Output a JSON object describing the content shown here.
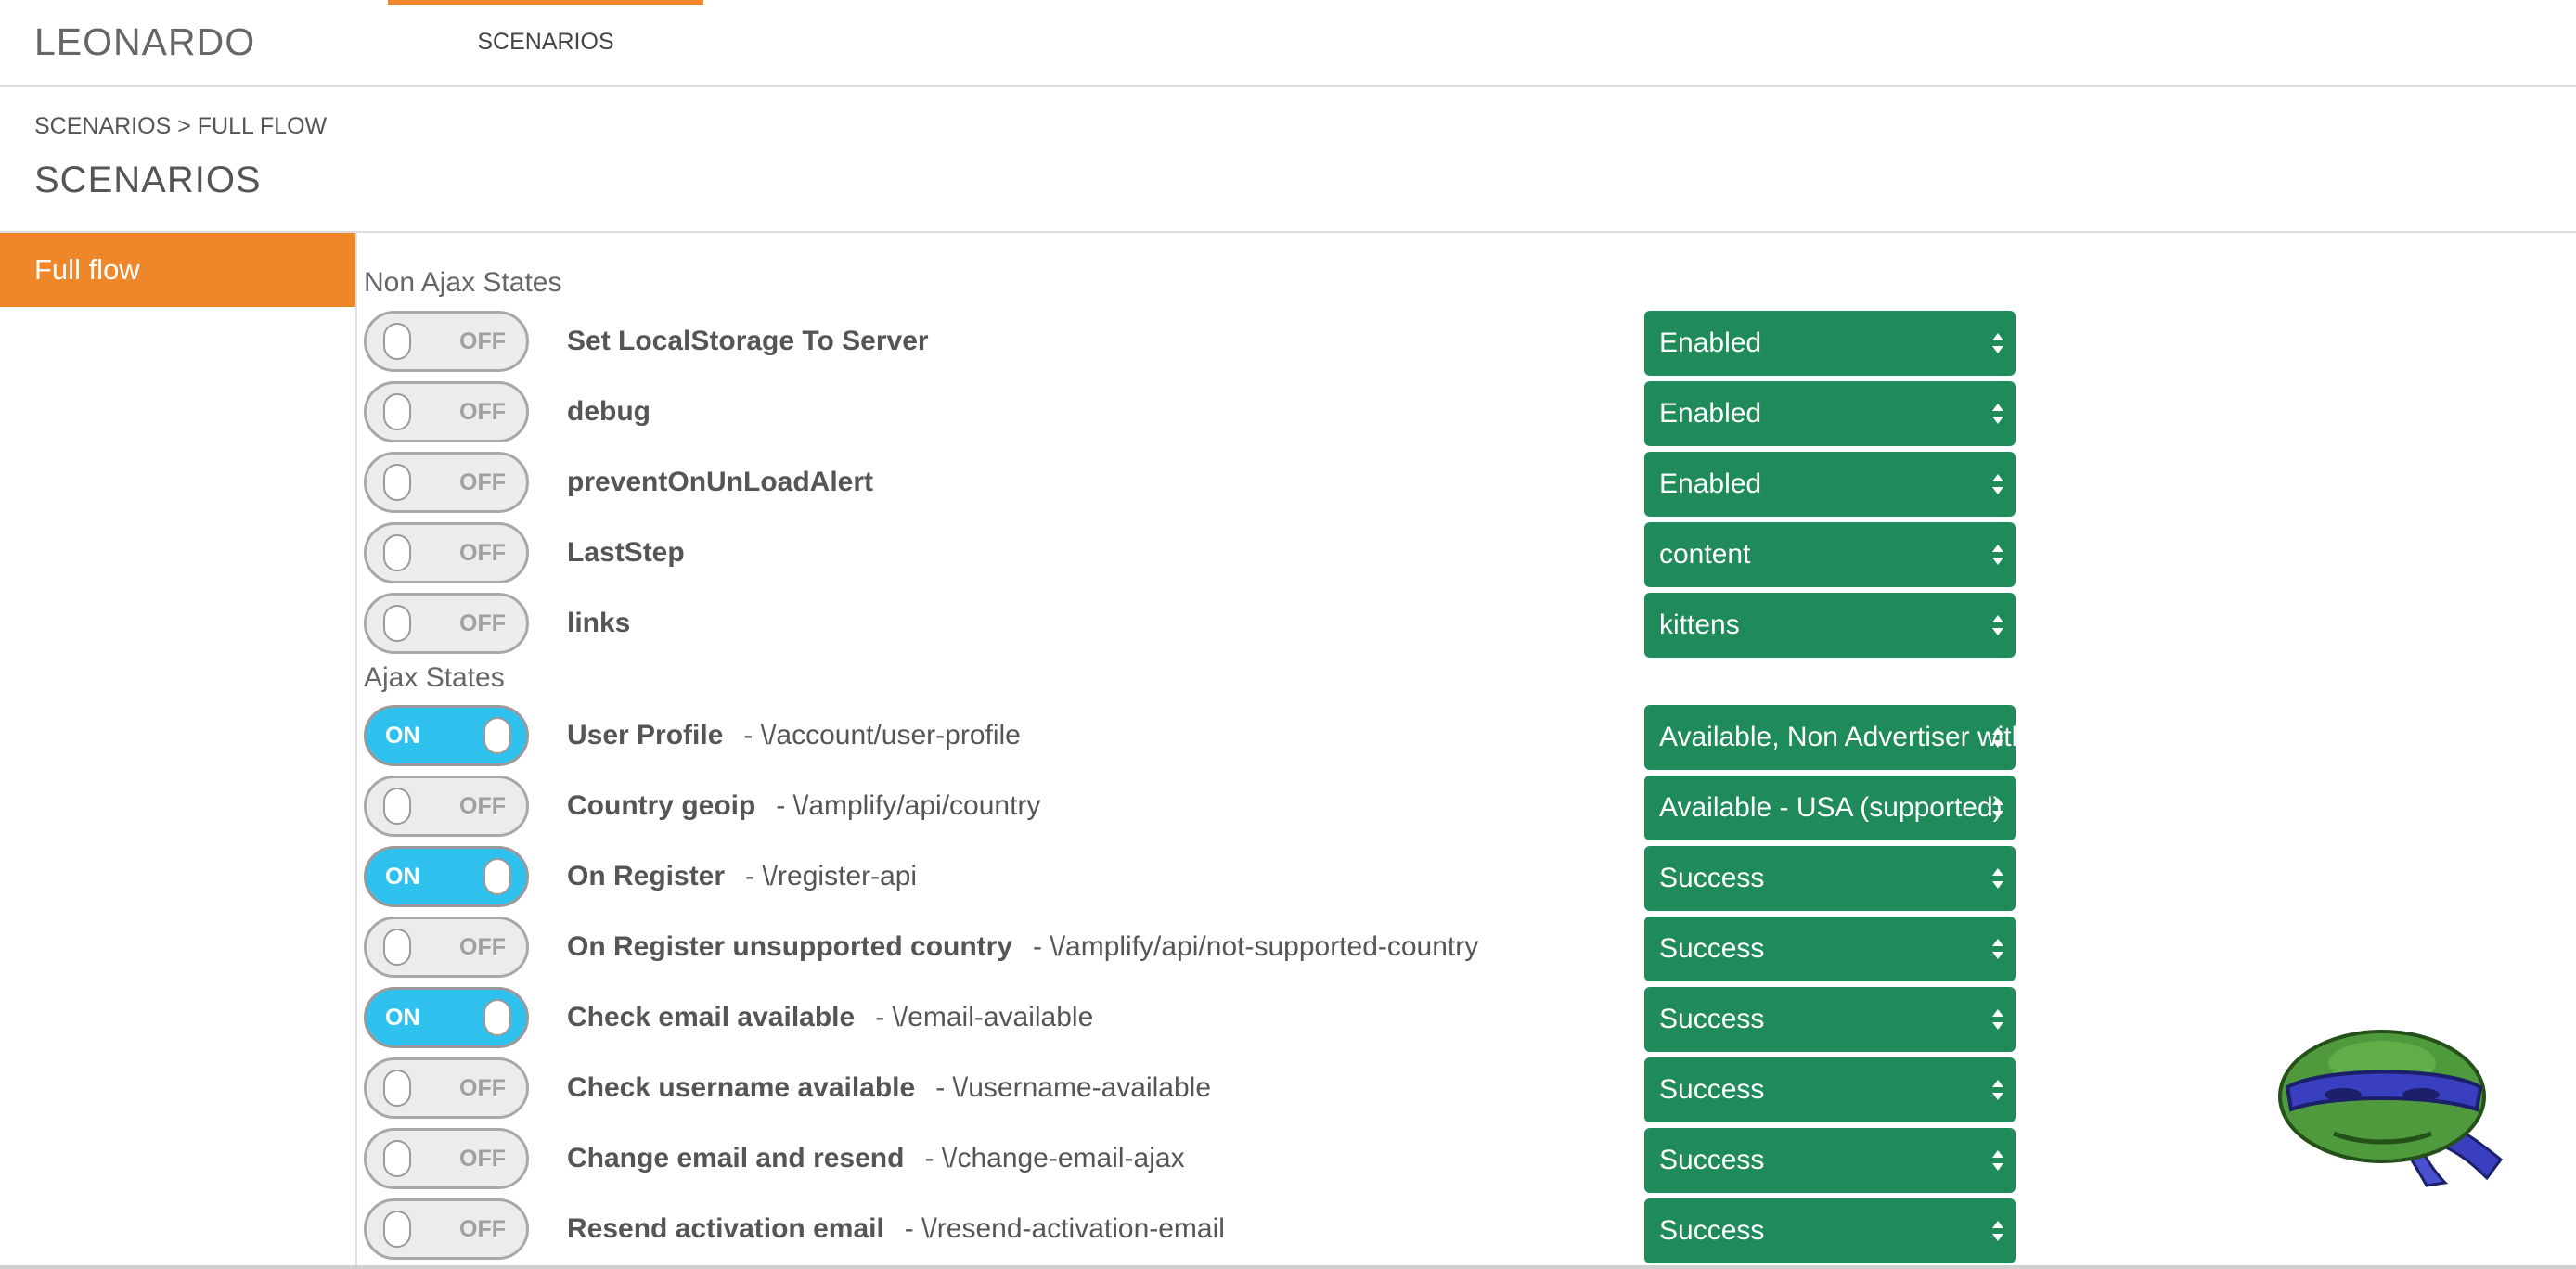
{
  "header": {
    "brand": "LEONARDO",
    "nav_tab": "SCENARIOS"
  },
  "breadcrumb": "SCENARIOS > FULL FLOW",
  "page_title": "SCENARIOS",
  "sidebar": {
    "items": [
      {
        "label": "Full flow",
        "active": true
      }
    ]
  },
  "colors": {
    "accent": "#f0862a",
    "toggle_on": "#2fc2ef",
    "select_bg": "#1f8a5a"
  },
  "non_ajax": {
    "title": "Non Ajax States",
    "rows": [
      {
        "name": "Set LocalStorage To Server",
        "path": "",
        "state": "OFF",
        "value": "Enabled"
      },
      {
        "name": "debug",
        "path": "",
        "state": "OFF",
        "value": "Enabled"
      },
      {
        "name": "preventOnUnLoadAlert",
        "path": "",
        "state": "OFF",
        "value": "Enabled"
      },
      {
        "name": "LastStep",
        "path": "",
        "state": "OFF",
        "value": "content"
      },
      {
        "name": "links",
        "path": "",
        "state": "OFF",
        "value": "kittens"
      }
    ]
  },
  "ajax": {
    "title": "Ajax States",
    "rows": [
      {
        "name": "User Profile",
        "path": "- \\/account/user-profile",
        "state": "ON",
        "value": "Available, Non Advertiser without"
      },
      {
        "name": "Country geoip",
        "path": "- \\/amplify/api/country",
        "state": "OFF",
        "value": "Available - USA (supported)"
      },
      {
        "name": "On Register",
        "path": "- \\/register-api",
        "state": "ON",
        "value": "Success"
      },
      {
        "name": "On Register unsupported country",
        "path": "- \\/amplify/api/not-supported-country",
        "state": "OFF",
        "value": "Success"
      },
      {
        "name": "Check email available",
        "path": "- \\/email-available",
        "state": "ON",
        "value": "Success"
      },
      {
        "name": "Check username available",
        "path": "- \\/username-available",
        "state": "OFF",
        "value": "Success"
      },
      {
        "name": "Change email and resend",
        "path": "- \\/change-email-ajax",
        "state": "OFF",
        "value": "Success"
      },
      {
        "name": "Resend activation email",
        "path": "- \\/resend-activation-email",
        "state": "OFF",
        "value": "Success"
      }
    ]
  }
}
